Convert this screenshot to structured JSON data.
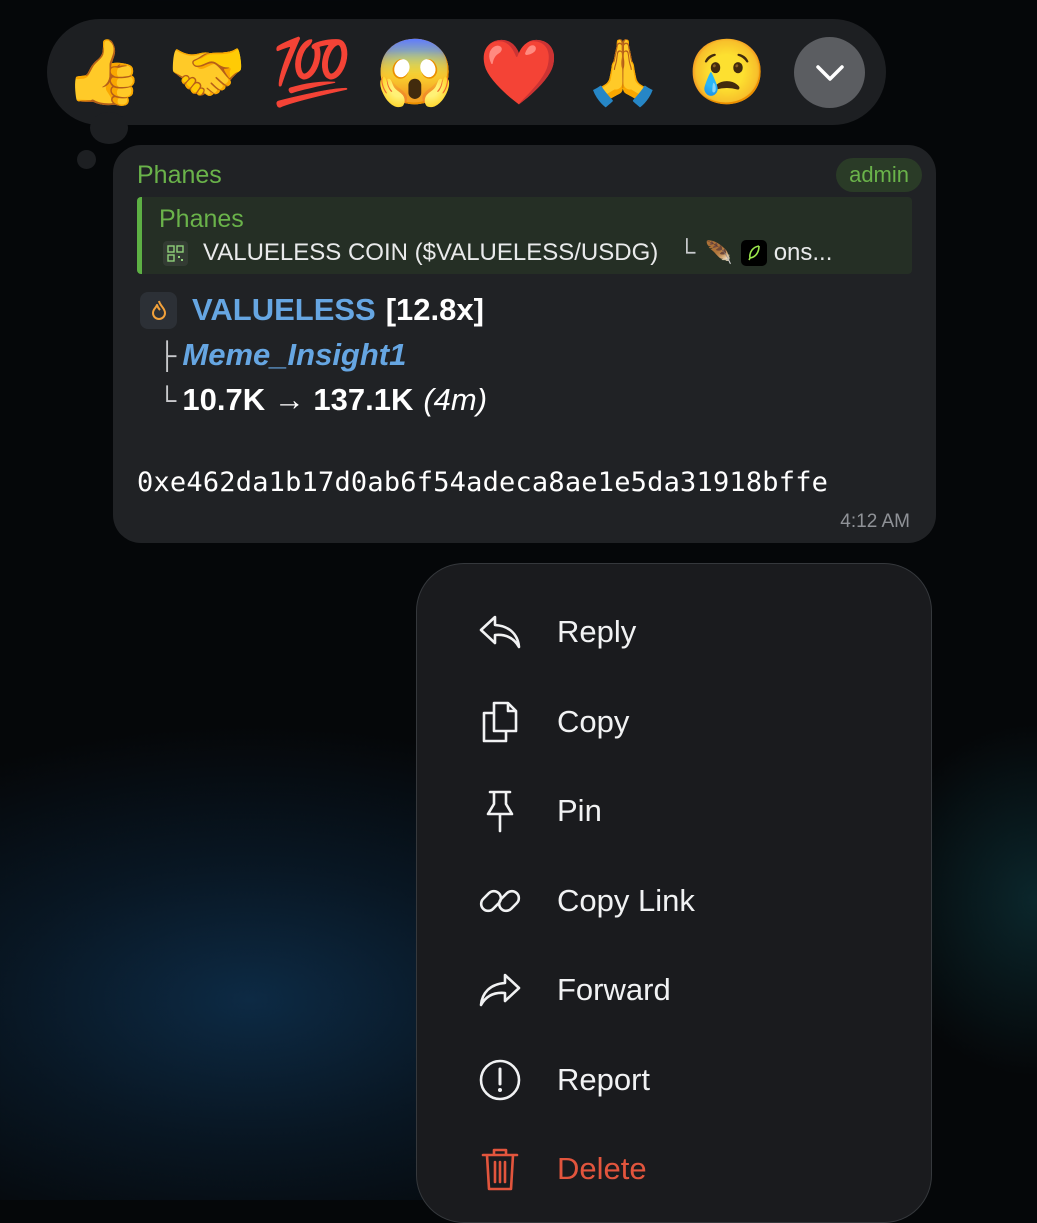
{
  "reactions": [
    {
      "emoji": "👍",
      "icon": "thumbs-up"
    },
    {
      "emoji": "🤝",
      "icon": "handshake"
    },
    {
      "emoji": "💯",
      "icon": "hundred-points"
    },
    {
      "emoji": "😱",
      "icon": "face-screaming"
    },
    {
      "emoji": "❤️",
      "icon": "red-heart"
    },
    {
      "emoji": "🙏",
      "icon": "folded-hands"
    },
    {
      "emoji": "😢",
      "icon": "crying-face"
    }
  ],
  "message": {
    "sender": "Phanes",
    "badge": "admin",
    "quote": {
      "sender": "Phanes",
      "text": "VALUELESS COIN ($VALUELESS/USDG)",
      "tail_glyph": "└",
      "feather_emoji": "🪶",
      "suffix": "ons..."
    },
    "token_name": "VALUELESS",
    "multiplier": "[12.8x]",
    "caller_prefix": "├",
    "caller": "Meme_Insight1",
    "mcap_prefix": "└",
    "mcap_change": "10.7K → 137.1K",
    "duration": "(4m)",
    "address": "0xe462da1b17d0ab6f54adeca8ae1e5da31918bffe",
    "time": "4:12 AM"
  },
  "menu": {
    "reply": "Reply",
    "copy": "Copy",
    "pin": "Pin",
    "copy_link": "Copy Link",
    "forward": "Forward",
    "report": "Report",
    "delete": "Delete"
  },
  "colors": {
    "sender_green": "#6ab34a",
    "link_blue": "#66a6e2",
    "danger_red": "#e2553d"
  }
}
